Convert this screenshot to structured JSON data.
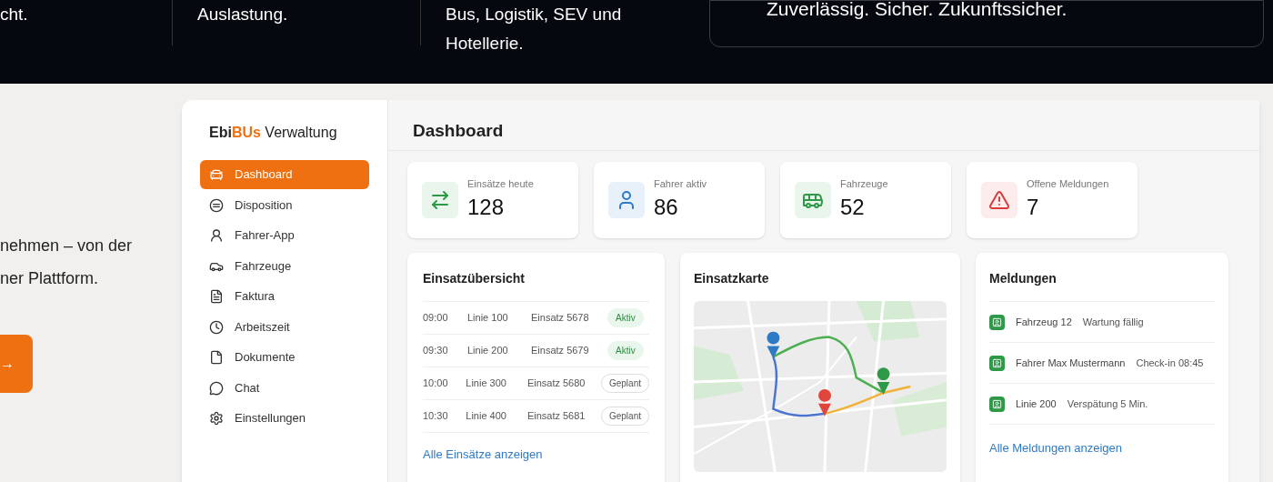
{
  "hero_band": {
    "columns": [
      {
        "lines": [
          "cht."
        ]
      },
      {
        "lines": [
          "Auslastung."
        ]
      },
      {
        "lines": [
          "Bus, Logistik, SEV und",
          "Hotellerie."
        ]
      }
    ],
    "tagline": "Zuverlässig. Sicher. Zukunftssicher."
  },
  "intro": {
    "lines": [
      "nehmen – von der",
      "ner Plattform."
    ],
    "button": {
      "label": "→"
    }
  },
  "app": {
    "logo": {
      "part_dark": "Ebi",
      "part_accent": "BUs",
      "suffix": "Verwaltung"
    },
    "sidebar": {
      "items": [
        {
          "label": "Dashboard",
          "selected": true
        },
        {
          "label": "Disposition",
          "selected": false
        },
        {
          "label": "Fahrer-App",
          "selected": false
        },
        {
          "label": "Fahrzeuge",
          "selected": false
        },
        {
          "label": "Faktura",
          "selected": false
        },
        {
          "label": "Arbeitszeit",
          "selected": false
        },
        {
          "label": "Dokumente",
          "selected": false
        },
        {
          "label": "Chat",
          "selected": false
        },
        {
          "label": "Einstellungen",
          "selected": false
        }
      ]
    },
    "title": "Dashboard",
    "stats": [
      {
        "label": "Einsätze heute",
        "value": "128",
        "kind": "green"
      },
      {
        "label": "Fahrer aktiv",
        "value": "86",
        "kind": "blue"
      },
      {
        "label": "Fahrzeuge",
        "value": "52",
        "kind": "green"
      },
      {
        "label": "Offene Meldungen",
        "value": "7",
        "kind": "red"
      }
    ],
    "overview": {
      "title": "Einsatzübersicht",
      "rows": [
        {
          "time": "09:00",
          "line": "Linie 100",
          "mission": "Einsatz 5678",
          "status": "Aktiv",
          "kind": "active"
        },
        {
          "time": "09:30",
          "line": "Linie 200",
          "mission": "Einsatz 5679",
          "status": "Aktiv",
          "kind": "active"
        },
        {
          "time": "10:00",
          "line": "Linie 300",
          "mission": "Einsatz 5680",
          "status": "Geplant",
          "kind": "planned"
        },
        {
          "time": "10:30",
          "line": "Linie 400",
          "mission": "Einsatz 5681",
          "status": "Geplant",
          "kind": "planned"
        }
      ],
      "link": "Alle Einsätze anzeigen"
    },
    "map": {
      "title": "Einsatzkarte"
    },
    "messages": {
      "title": "Meldungen",
      "items": [
        {
          "subject": "Fahrzeug 12",
          "detail": "Wartung fällig"
        },
        {
          "subject": "Fahrer Max Mustermann",
          "detail": "Check-in 08:45"
        },
        {
          "subject": "Linie 200",
          "detail": "Verspätung 5 Min."
        }
      ],
      "link": "Alle Meldungen anzeigen"
    }
  }
}
